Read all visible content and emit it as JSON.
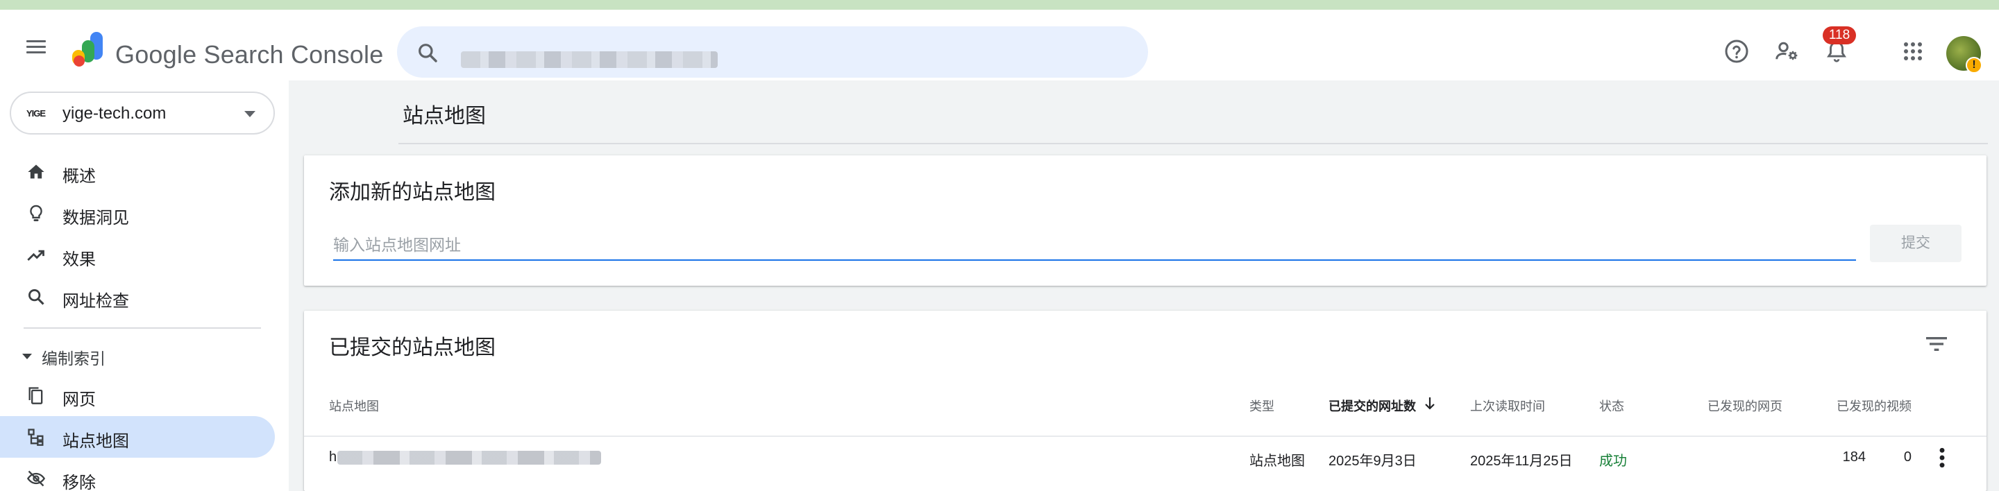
{
  "header": {
    "product_name": "Google Search Console",
    "search": {
      "placeholder": "",
      "value": ""
    },
    "notifications_count": "118",
    "icons": [
      "menu-icon",
      "search-icon",
      "help-icon",
      "manage-users-icon",
      "notifications-icon",
      "apps-icon",
      "account-avatar"
    ]
  },
  "sidebar": {
    "property": {
      "logo_text": "YIGE",
      "name": "yige-tech.com"
    },
    "items": [
      {
        "label": "概述",
        "icon": "home-icon"
      },
      {
        "label": "数据洞见",
        "icon": "lightbulb-icon"
      },
      {
        "label": "效果",
        "icon": "trending-up-icon"
      },
      {
        "label": "网址检查",
        "icon": "search-icon"
      }
    ],
    "section": {
      "label": "编制索引"
    },
    "index_items": [
      {
        "label": "网页",
        "icon": "pages-icon"
      },
      {
        "label": "站点地图",
        "icon": "sitemap-icon",
        "active": true
      },
      {
        "label": "移除",
        "icon": "visibility-off-icon"
      }
    ]
  },
  "main": {
    "page_title": "站点地图",
    "add_card": {
      "title": "添加新的站点地图",
      "input_placeholder": "输入站点地图网址",
      "submit_label": "提交"
    },
    "submitted_card": {
      "title": "已提交的站点地图",
      "columns": [
        "站点地图",
        "类型",
        "已提交的网址数",
        "上次读取时间",
        "状态",
        "已发现的网页",
        "已发现的视频"
      ],
      "rows": [
        {
          "sitemap": "h",
          "type": "站点地图",
          "submitted": "2025年9月3日",
          "last_read": "2025年11月25日",
          "status": "成功",
          "discovered_pages": "184",
          "discovered_videos": "0"
        }
      ]
    }
  },
  "colors": {
    "accent": "#1a73e8",
    "active_nav_bg": "#d2e3fc",
    "success": "#188038",
    "badge": "#d93025"
  }
}
